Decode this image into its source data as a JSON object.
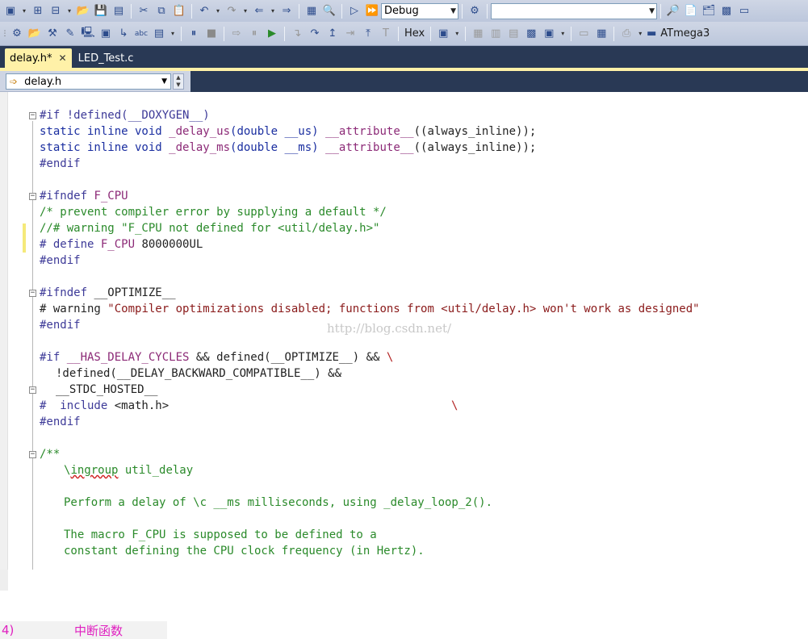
{
  "toolbar_top": {
    "configuration": "Debug",
    "search_value": ""
  },
  "toolbar_bottom": {
    "hex_label": "Hex",
    "device_label": "ATmega3"
  },
  "tabs": [
    {
      "label": "delay.h*",
      "active": true
    },
    {
      "label": "LED_Test.c",
      "active": false
    }
  ],
  "nav": {
    "file_combo": "delay.h"
  },
  "code": {
    "l1": "#if !defined(__DOXYGEN__)",
    "l2a": "static inline void ",
    "l2b": "_delay_us",
    "l2c": "(double __us) ",
    "l2d": "__attribute__",
    "l2e": "((always_inline));",
    "l3a": "static inline void ",
    "l3b": "_delay_ms",
    "l3c": "(double __ms) ",
    "l3d": "__attribute__",
    "l3e": "((always_inline));",
    "l4": "#endif",
    "l6a": "#ifndef ",
    "l6b": "F_CPU",
    "l7": "/* prevent compiler error by supplying a default */",
    "l8": "//# warning \"F_CPU not defined for <util/delay.h>\"",
    "l9a": "# define ",
    "l9b": "F_CPU",
    "l9c": " 8000000UL",
    "l10": "#endif",
    "l12a": "#ifndef ",
    "l12b": "__OPTIMIZE__",
    "l13a": "# warning ",
    "l13b": "\"Compiler optimizations disabled; functions from <util/delay.h> won't work as designed\"",
    "l14": "#endif",
    "l16a": "#if ",
    "l16b": "__HAS_DELAY_CYCLES",
    "l16c": " && defined(__OPTIMIZE__) && ",
    "l16d": "\\",
    "l17a": "!defined(__DELAY_BACKWARD_COMPATIBLE__) &&",
    "l17b": "\\",
    "l18": "__STDC_HOSTED__",
    "l19a": "#  include ",
    "l19b": "<math.h>",
    "l20": "#endif",
    "l22": "/**",
    "l23a": "\\",
    "l23b": "ingroup",
    "l23c": " util_delay",
    "l25": "Perform a delay of \\c __ms milliseconds, using _delay_loop_2().",
    "l27": "The macro F_CPU is supposed to be defined to a",
    "l28": "constant defining the CPU clock frequency (in Hertz)."
  },
  "watermark": "http://blog.csdn.net/",
  "footer": {
    "number": "4)",
    "title": "中断函数"
  }
}
